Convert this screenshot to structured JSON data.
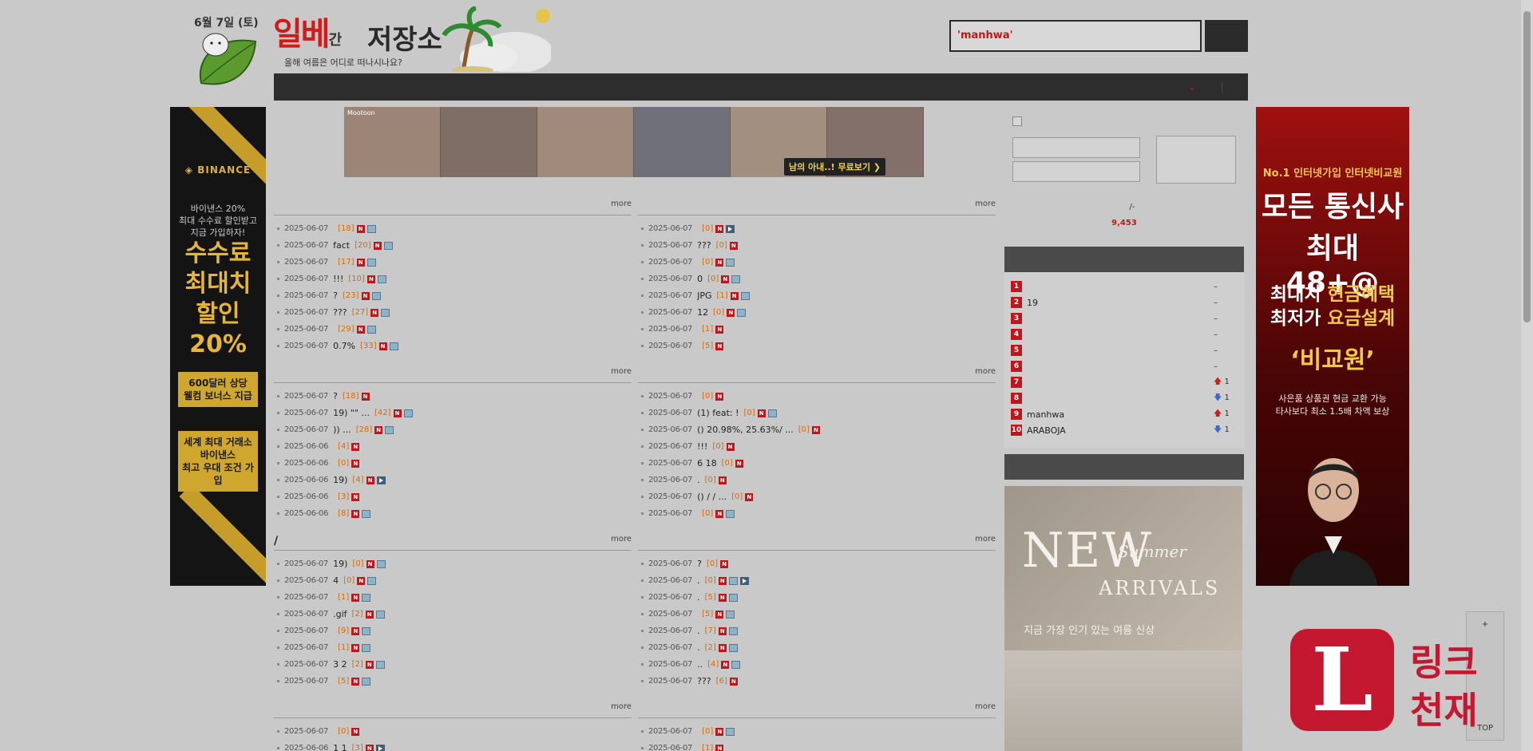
{
  "header": {
    "date": "6월 7일 (토)",
    "logo_main": "일베",
    "logo_gan": "간",
    "logo_store": "저장소",
    "logo_sub": "올해 여름은 어디로 떠나시나요?",
    "search_keyword": "'manhwa'",
    "search_rest": "",
    "search_button": ""
  },
  "nav": {
    "items": [
      "",
      "",
      "",
      "",
      "",
      "",
      "",
      "",
      ""
    ],
    "right_label": "",
    "right_last": ""
  },
  "ads": {
    "left": {
      "brand": "◈ BINANCE",
      "small_1": "바이낸스 20%",
      "small_2": "최대 수수료 할인받고",
      "small_3": "지금 가입하자!",
      "big_1": "수수료",
      "big_2": "최대치",
      "big_3": "할인",
      "big_4": "20%",
      "box1_1": "600달러 상당",
      "box1_2": "웰컴 보너스 지급",
      "box2_1": "세계 최대 거래소",
      "box2_2": "바이낸스",
      "box2_3": "최고 우대 조건 가입"
    },
    "right": {
      "t1": "No.1 인터넷가입 인터넷비교원",
      "t2": "모든 통신사",
      "t3": "최대 48+@",
      "t4a_white": "최대치 ",
      "t4a_yellow": "현금혜택",
      "t4b_white": "최저가 ",
      "t4b_yellow": "요금설계",
      "t5": "‘비교원’",
      "t6_1": "사은품 상품권 현금 교환 가능",
      "t6_2": "타사보다 최소 1.5배 차액 보상"
    },
    "banner_tag": "Mootoon",
    "banner_cta": "남의 아내..! 무료보기 ❯"
  },
  "boards": [
    {
      "title": "",
      "more": "more",
      "rows": [
        {
          "date": "2025-06-07",
          "title": "",
          "count": "[18]"
        },
        {
          "date": "2025-06-07",
          "title": "fact",
          "count": "[20]"
        },
        {
          "date": "2025-06-07",
          "title": "",
          "count": "[17]"
        },
        {
          "date": "2025-06-07",
          "title": "!!!",
          "count": "[10]"
        },
        {
          "date": "2025-06-07",
          "title": "?",
          "count": "[23]"
        },
        {
          "date": "2025-06-07",
          "title": "???",
          "count": "[27]"
        },
        {
          "date": "2025-06-07",
          "title": "",
          "count": "[29]"
        },
        {
          "date": "2025-06-07",
          "title": "0.7%",
          "count": "[33]"
        }
      ]
    },
    {
      "title": "",
      "more": "more",
      "rows": [
        {
          "date": "2025-06-07",
          "title": "",
          "count": "[0]"
        },
        {
          "date": "2025-06-07",
          "title": "???",
          "count": "[0]"
        },
        {
          "date": "2025-06-07",
          "title": "",
          "count": "[0]"
        },
        {
          "date": "2025-06-07",
          "title": "0",
          "count": "[0]"
        },
        {
          "date": "2025-06-07",
          "title": "JPG",
          "count": "[1]"
        },
        {
          "date": "2025-06-07",
          "title": "12",
          "count": "[0]"
        },
        {
          "date": "2025-06-07",
          "title": "",
          "count": "[1]"
        },
        {
          "date": "2025-06-07",
          "title": "",
          "count": "[5]"
        }
      ]
    },
    {
      "title": "",
      "more": "more",
      "rows": [
        {
          "date": "2025-06-07",
          "title": "?",
          "count": "[18]"
        },
        {
          "date": "2025-06-07",
          "title": "19) \"\" ...",
          "count": "[42]"
        },
        {
          "date": "2025-06-07",
          "title": ")) ...",
          "count": "[28]"
        },
        {
          "date": "2025-06-06",
          "title": "",
          "count": "[4]"
        },
        {
          "date": "2025-06-06",
          "title": "",
          "count": "[0]"
        },
        {
          "date": "2025-06-06",
          "title": "19)",
          "count": "[4]"
        },
        {
          "date": "2025-06-06",
          "title": "",
          "count": "[3]"
        },
        {
          "date": "2025-06-06",
          "title": "",
          "count": "[8]"
        }
      ]
    },
    {
      "title": "",
      "more": "more",
      "rows": [
        {
          "date": "2025-06-07",
          "title": "",
          "count": "[0]"
        },
        {
          "date": "2025-06-07",
          "title": "(1) feat: !",
          "count": "[0]"
        },
        {
          "date": "2025-06-07",
          "title": "() 20.98%, 25.63%/ ...",
          "count": "[0]"
        },
        {
          "date": "2025-06-07",
          "title": "!!!",
          "count": "[0]"
        },
        {
          "date": "2025-06-07",
          "title": "6 18",
          "count": "[0]"
        },
        {
          "date": "2025-06-07",
          "title": ".",
          "count": "[0]"
        },
        {
          "date": "2025-06-07",
          "title": "() / / ...",
          "count": "[0]"
        },
        {
          "date": "2025-06-07",
          "title": "",
          "count": "[0]"
        }
      ]
    },
    {
      "title": "/",
      "more": "more",
      "rows": [
        {
          "date": "2025-06-07",
          "title": "19)",
          "count": "[0]"
        },
        {
          "date": "2025-06-07",
          "title": "4",
          "count": "[0]"
        },
        {
          "date": "2025-06-07",
          "title": "",
          "count": "[1]"
        },
        {
          "date": "2025-06-07",
          "title": ".gif",
          "count": "[2]"
        },
        {
          "date": "2025-06-07",
          "title": "",
          "count": "[9]"
        },
        {
          "date": "2025-06-07",
          "title": "",
          "count": "[1]"
        },
        {
          "date": "2025-06-07",
          "title": "3 2",
          "count": "[2]"
        },
        {
          "date": "2025-06-07",
          "title": "",
          "count": "[5]"
        }
      ]
    },
    {
      "title": "",
      "more": "more",
      "rows": [
        {
          "date": "2025-06-07",
          "title": "?",
          "count": "[0]"
        },
        {
          "date": "2025-06-07",
          "title": ".",
          "count": "[0]"
        },
        {
          "date": "2025-06-07",
          "title": ".",
          "count": "[5]"
        },
        {
          "date": "2025-06-07",
          "title": "",
          "count": "[5]"
        },
        {
          "date": "2025-06-07",
          "title": ".",
          "count": "[7]"
        },
        {
          "date": "2025-06-07",
          "title": ".",
          "count": "[2]"
        },
        {
          "date": "2025-06-07",
          "title": "..",
          "count": "[4]"
        },
        {
          "date": "2025-06-07",
          "title": "???",
          "count": "[6]"
        }
      ]
    },
    {
      "title": "",
      "more": "more",
      "rows": [
        {
          "date": "2025-06-07",
          "title": "",
          "count": "[0]"
        },
        {
          "date": "2025-06-06",
          "title": "1 1",
          "count": "[3]"
        }
      ]
    },
    {
      "title": "",
      "more": "more",
      "rows": [
        {
          "date": "2025-06-07",
          "title": "",
          "count": "[0]"
        },
        {
          "date": "2025-06-07",
          "title": "",
          "count": "[1]"
        }
      ]
    }
  ],
  "login": {
    "keep_label": "",
    "id_placeholder": "",
    "pw_placeholder": "",
    "login_button": "",
    "link_1": "",
    "link_2": "/-",
    "count_prefix": "",
    "count_value": "9,453",
    "count_suffix": ""
  },
  "ranking": {
    "title": "",
    "footer": "",
    "items": [
      {
        "rank": "1",
        "keyword": "",
        "change": "–",
        "dir": "none"
      },
      {
        "rank": "2",
        "keyword": "19",
        "change": "–",
        "dir": "none"
      },
      {
        "rank": "3",
        "keyword": "",
        "change": "–",
        "dir": "none"
      },
      {
        "rank": "4",
        "keyword": "",
        "change": "–",
        "dir": "none"
      },
      {
        "rank": "5",
        "keyword": "",
        "change": "–",
        "dir": "none"
      },
      {
        "rank": "6",
        "keyword": "",
        "change": "–",
        "dir": "none"
      },
      {
        "rank": "7",
        "keyword": "",
        "change": "1",
        "dir": "up"
      },
      {
        "rank": "8",
        "keyword": "",
        "change": "1",
        "dir": "down"
      },
      {
        "rank": "9",
        "keyword": "manhwa",
        "change": "1",
        "dir": "up"
      },
      {
        "rank": "10",
        "keyword": "ARABOJA",
        "change": "1",
        "dir": "down"
      }
    ]
  },
  "fashion": {
    "new": "NEW",
    "summer": "Summer",
    "arrivals": "ARRIVALS",
    "caption": "지금 가장 인기 있는 여름 신상"
  },
  "widgets": {
    "plus": "+",
    "top": "TOP",
    "link_L": "L",
    "link_w1": "링크",
    "link_w2": "천재"
  },
  "colors": {
    "accent_red": "#c0161b",
    "nav_bg": "#2d2d2d",
    "count_orange": "#d46a0c"
  }
}
